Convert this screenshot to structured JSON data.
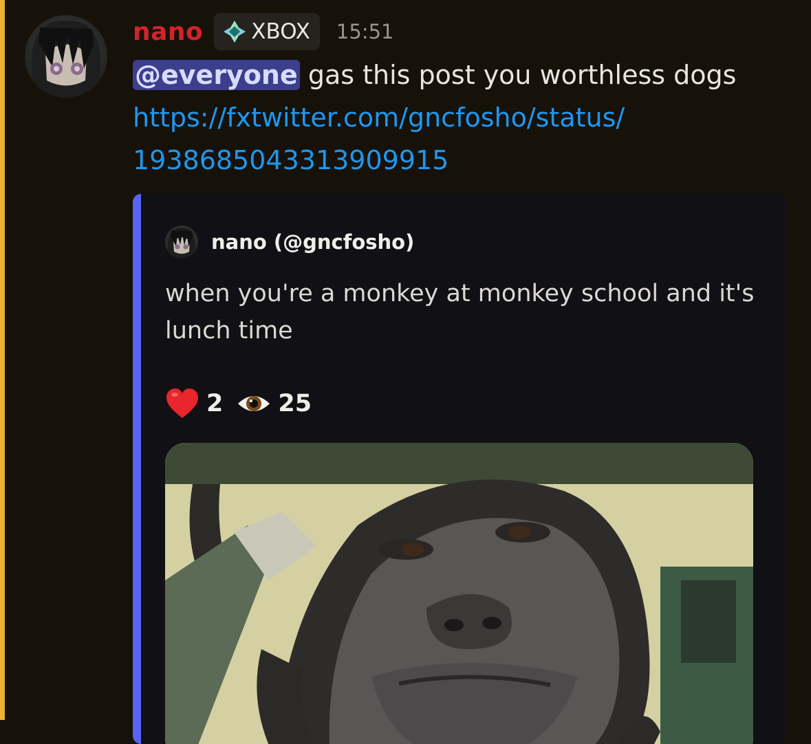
{
  "message": {
    "author": "nano",
    "tag": "XBOX",
    "timestamp": "15:51",
    "mention": "@everyone",
    "text": " gas this post you worthless dogs",
    "link_line1": "https://fxtwitter.com/gncfosho/status/",
    "link_line2": "1938685043313909915"
  },
  "embed": {
    "author": "nano (@gncfosho)",
    "description": "when you're a monkey at monkey school and it's lunch time",
    "likes": "2",
    "views": "25"
  },
  "colors": {
    "background": "#16120a",
    "mention_bar": "#f0b232",
    "username": "#d2232a",
    "link": "#1e97f0",
    "embed_bar": "#5865f2"
  },
  "icons": {
    "heart": "heart-icon",
    "eye": "eye-icon",
    "tag": "xbox-tag-icon"
  }
}
